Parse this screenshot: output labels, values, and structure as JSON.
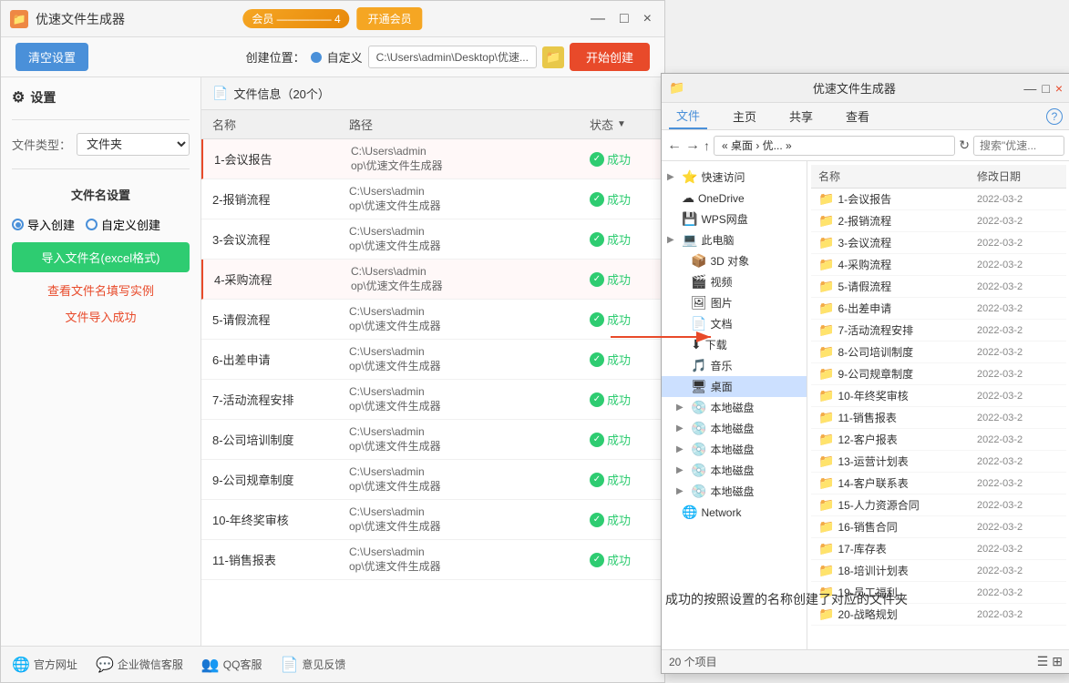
{
  "app": {
    "title": "优速文件生成器",
    "logo_text": "优",
    "window_controls": [
      "—",
      "□",
      "×"
    ]
  },
  "toolbar": {
    "clear_label": "清空设置",
    "create_location_label": "创建位置：",
    "radio_custom": "自定义",
    "path_value": "C:\\Users\\admin\\Desktop\\优速...",
    "start_label": "开始创建"
  },
  "vip": {
    "badge_text": "会员 ————— 4",
    "open_label": "开通会员"
  },
  "sidebar": {
    "settings_label": "设置",
    "file_type_label": "文件类型：",
    "file_type_value": "文件夹",
    "section_title": "文件名设置",
    "radio1": "导入创建",
    "radio2": "自定义创建",
    "import_btn": "导入文件名(excel格式)",
    "link_text": "查看文件名填写实例",
    "success_text": "文件导入成功"
  },
  "file_list": {
    "header": "文件信息（20个）",
    "col_name": "名称",
    "col_path": "路径",
    "col_status": "状态",
    "files": [
      {
        "name": "1-会议报告",
        "path": "C:\\Users\\admin\\Desktop\\优速文件生成器",
        "status": "成功",
        "highlighted": true
      },
      {
        "name": "2-报销流程",
        "path": "C:\\Users\\admin\\Desktop\\优速文件生成器",
        "status": "成功"
      },
      {
        "name": "3-会议流程",
        "path": "C:\\Users\\admin\\Desktop\\优速文件生成器",
        "status": "成功"
      },
      {
        "name": "4-采购流程",
        "path": "C:\\Users\\admin\\Desktop\\优速文件生成器",
        "status": "成功",
        "highlighted": true
      },
      {
        "name": "5-请假流程",
        "path": "C:\\Users\\admin\\Desktop\\优速文件生成器",
        "status": "成功"
      },
      {
        "name": "6-出差申请",
        "path": "C:\\Users\\admin\\Desktop\\优速文件生成器",
        "status": "成功"
      },
      {
        "name": "7-活动流程安排",
        "path": "C:\\Users\\admin\\Desktop\\优速文件生成器",
        "status": "成功"
      },
      {
        "name": "8-公司培训制度",
        "path": "C:\\Users\\admin\\Desktop\\优速文件生成器",
        "status": "成功"
      },
      {
        "name": "9-公司规章制度",
        "path": "C:\\Users\\admin\\Desktop\\优速文件生成器",
        "status": "成功"
      },
      {
        "name": "10-年终奖审核",
        "path": "C:\\Users\\admin\\Desktop\\优速文件生成器",
        "status": "成功"
      },
      {
        "name": "11-销售报表",
        "path": "C:\\Users\\admin\\Desktop\\优速文件生成器",
        "status": "成功"
      }
    ]
  },
  "bottom_bar": {
    "items": [
      {
        "icon": "🌐",
        "label": "官方网址"
      },
      {
        "icon": "💬",
        "label": "企业微信客服"
      },
      {
        "icon": "👥",
        "label": "QQ客服"
      },
      {
        "icon": "📄",
        "label": "意见反馈"
      }
    ]
  },
  "explorer": {
    "title": "优速文件生成器",
    "tabs": [
      "文件",
      "主页",
      "共享",
      "查看"
    ],
    "address": "« 桌面 › 优... »",
    "search_placeholder": "搜索\"优速...",
    "tree_items": [
      {
        "label": "快速访问",
        "icon": "⭐",
        "indent": 0,
        "has_arrow": true
      },
      {
        "label": "OneDrive",
        "icon": "☁",
        "indent": 0,
        "has_arrow": false
      },
      {
        "label": "WPS网盘",
        "icon": "💾",
        "indent": 0,
        "has_arrow": false
      },
      {
        "label": "此电脑",
        "icon": "💻",
        "indent": 0,
        "has_arrow": true
      },
      {
        "label": "3D 对象",
        "icon": "📦",
        "indent": 1,
        "has_arrow": false
      },
      {
        "label": "视频",
        "icon": "🎬",
        "indent": 1,
        "has_arrow": false
      },
      {
        "label": "图片",
        "icon": "🖼",
        "indent": 1,
        "has_arrow": false
      },
      {
        "label": "文档",
        "icon": "📄",
        "indent": 1,
        "has_arrow": false
      },
      {
        "label": "下载",
        "icon": "⬇",
        "indent": 1,
        "has_arrow": false
      },
      {
        "label": "音乐",
        "icon": "🎵",
        "indent": 1,
        "has_arrow": false
      },
      {
        "label": "桌面",
        "icon": "🖥",
        "indent": 1,
        "has_arrow": false,
        "selected": true
      },
      {
        "label": "本地磁盘",
        "icon": "💿",
        "indent": 1,
        "has_arrow": true
      },
      {
        "label": "本地磁盘",
        "icon": "💿",
        "indent": 1,
        "has_arrow": true
      },
      {
        "label": "本地磁盘",
        "icon": "💿",
        "indent": 1,
        "has_arrow": true
      },
      {
        "label": "本地磁盘",
        "icon": "💿",
        "indent": 1,
        "has_arrow": true
      },
      {
        "label": "本地磁盘",
        "icon": "💿",
        "indent": 1,
        "has_arrow": true
      },
      {
        "label": "Network",
        "icon": "🌐",
        "indent": 0,
        "has_arrow": false
      }
    ],
    "files": [
      {
        "name": "1-会议报告",
        "date": "2022-03-2"
      },
      {
        "name": "2-报销流程",
        "date": "2022-03-2"
      },
      {
        "name": "3-会议流程",
        "date": "2022-03-2"
      },
      {
        "name": "4-采购流程",
        "date": "2022-03-2"
      },
      {
        "name": "5-请假流程",
        "date": "2022-03-2"
      },
      {
        "name": "6-出差申请",
        "date": "2022-03-2"
      },
      {
        "name": "7-活动流程安排",
        "date": "2022-03-2"
      },
      {
        "name": "8-公司培训制度",
        "date": "2022-03-2"
      },
      {
        "name": "9-公司规章制度",
        "date": "2022-03-2"
      },
      {
        "name": "10-年终奖审核",
        "date": "2022-03-2"
      },
      {
        "name": "11-销售报表",
        "date": "2022-03-2"
      },
      {
        "name": "12-客户报表",
        "date": "2022-03-2"
      },
      {
        "name": "13-运营计划表",
        "date": "2022-03-2"
      },
      {
        "name": "14-客户联系表",
        "date": "2022-03-2"
      },
      {
        "name": "15-人力资源合同",
        "date": "2022-03-2"
      },
      {
        "name": "16-销售合同",
        "date": "2022-03-2"
      },
      {
        "name": "17-库存表",
        "date": "2022-03-2"
      },
      {
        "name": "18-培训计划表",
        "date": "2022-03-2"
      },
      {
        "name": "19-员工福利",
        "date": "2022-03-2"
      },
      {
        "name": "20-战略规划",
        "date": "2022-03-2"
      }
    ],
    "status_bar": "20 个项目",
    "success_message": "成功的按照设置的名称创建了对应的文件夹"
  }
}
